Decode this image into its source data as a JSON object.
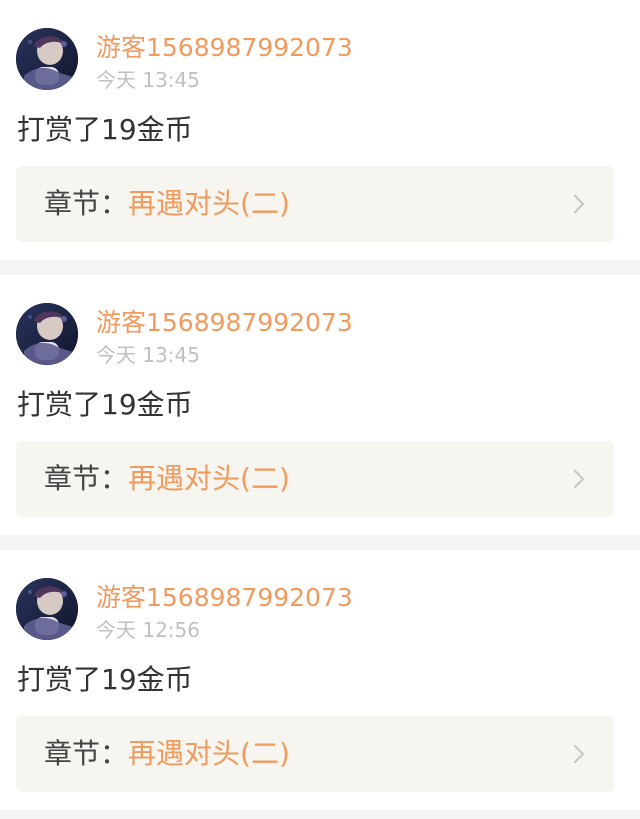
{
  "feed": {
    "items": [
      {
        "username": "游客1568987992073",
        "time": "今天 13:45",
        "content": "打赏了19金币",
        "chapter_label": "章节：",
        "chapter_title": "再遇对头(二)"
      },
      {
        "username": "游客1568987992073",
        "time": "今天 13:45",
        "content": "打赏了19金币",
        "chapter_label": "章节：",
        "chapter_title": "再遇对头(二)"
      },
      {
        "username": "游客1568987992073",
        "time": "今天 12:56",
        "content": "打赏了19金币",
        "chapter_label": "章节：",
        "chapter_title": "再遇对头(二)"
      }
    ]
  },
  "theme": {
    "accent": "#f09a5e",
    "muted": "#c0c0c0",
    "text": "#333333",
    "chapter_bg": "#f6f5ef",
    "divider_bg": "#f6f4f3"
  },
  "icons": {
    "avatar": "user-avatar-image",
    "chevron": "chevron-right-icon"
  }
}
